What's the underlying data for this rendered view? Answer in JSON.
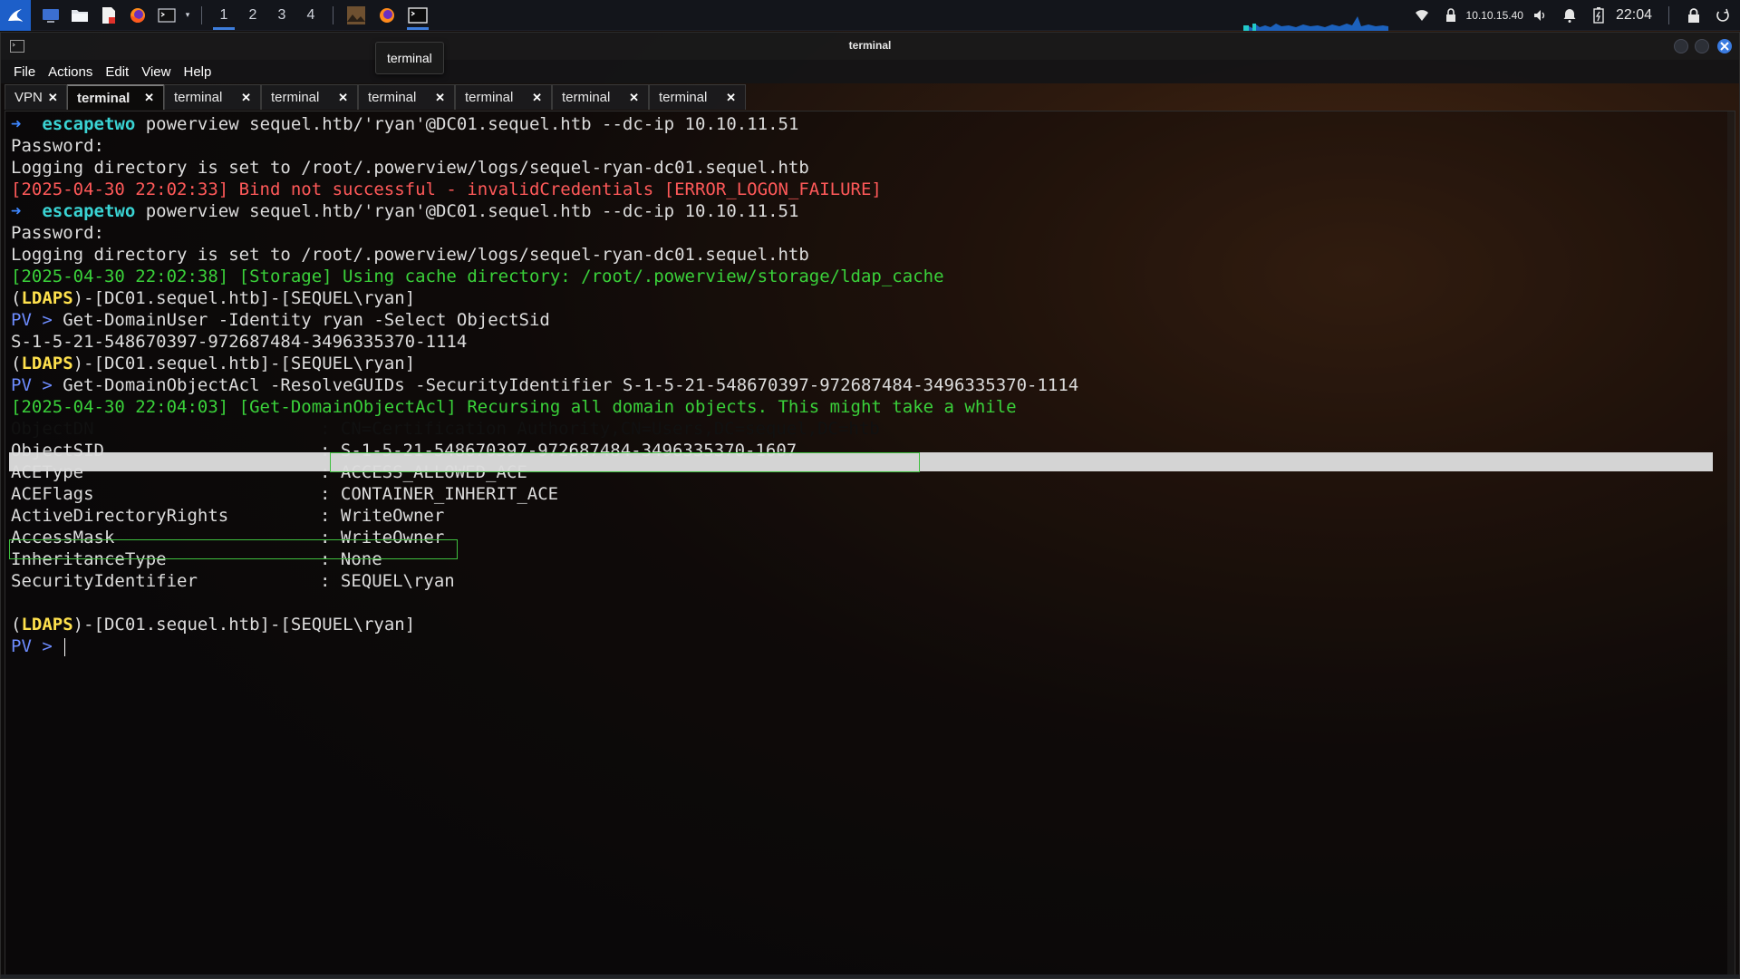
{
  "panel": {
    "workspaces": [
      "1",
      "2",
      "3",
      "4"
    ],
    "active_workspace": "1",
    "ip": "10.10.15.40",
    "time": "22:04",
    "icons": [
      "kali-menu-icon",
      "desktop-icon",
      "file-manager-icon",
      "text-editor-icon",
      "firefox-icon",
      "terminal-icon",
      "wifi-icon",
      "vpn-icon",
      "volume-icon",
      "bell-icon",
      "battery-icon",
      "lock-icon",
      "power-icon"
    ],
    "accent": "#3d7ddc"
  },
  "window": {
    "title": "terminal",
    "tooltip": "terminal",
    "menu": [
      "File",
      "Actions",
      "Edit",
      "View",
      "Help"
    ],
    "tabs": [
      "VPN",
      "terminal",
      "terminal",
      "terminal",
      "terminal",
      "terminal",
      "terminal",
      "terminal"
    ],
    "active_tab_index": 1
  },
  "terminal": {
    "prompt_arrow": "➜",
    "prompt_dir": "escapetwo",
    "cmd1": " powerview sequel.htb/'ryan'@DC01.sequel.htb --dc-ip 10.10.11.51",
    "password": "Password:",
    "logdir": "Logging directory is set to /root/.powerview/logs/sequel-ryan-dc01.sequel.htb",
    "error": "[2025-04-30 22:02:33] Bind not successful - invalidCredentials [ERROR_LOGON_FAILURE]",
    "cache": "[2025-04-30 22:02:38] [Storage] Using cache directory: /root/.powerview/storage/ldap_cache",
    "ps_open": "(",
    "ps_ldaps": "LDAPS",
    "ps_rest": ")-[DC01.sequel.htb]-[SEQUEL\\ryan]",
    "pv": "PV > ",
    "cmd_user": "Get-DomainUser -Identity ryan -Select ObjectSid",
    "sid_result": "S-1-5-21-548670397-972687484-3496335370-1114",
    "cmd_acl": "Get-DomainObjectAcl -ResolveGUIDs -SecurityIdentifier S-1-5-21-548670397-972687484-3496335370-1114",
    "recurse": "[2025-04-30 22:04:03] [Get-DomainObjectAcl] Recursing all domain objects. This might take a while",
    "acl": [
      {
        "k": "ObjectDN",
        "v": "CN=Certification Authority,CN=Users,DC=sequel,DC=htb"
      },
      {
        "k": "ObjectSID",
        "v": "S-1-5-21-548670397-972687484-3496335370-1607"
      },
      {
        "k": "ACEType",
        "v": "ACCESS_ALLOWED_ACE"
      },
      {
        "k": "ACEFlags",
        "v": "CONTAINER_INHERIT_ACE"
      },
      {
        "k": "ActiveDirectoryRights",
        "v": "WriteOwner"
      },
      {
        "k": "AccessMask",
        "v": "WriteOwner"
      },
      {
        "k": "InheritanceType",
        "v": "None"
      },
      {
        "k": "SecurityIdentifier",
        "v": "SEQUEL\\ryan"
      }
    ],
    "colon": ": "
  }
}
